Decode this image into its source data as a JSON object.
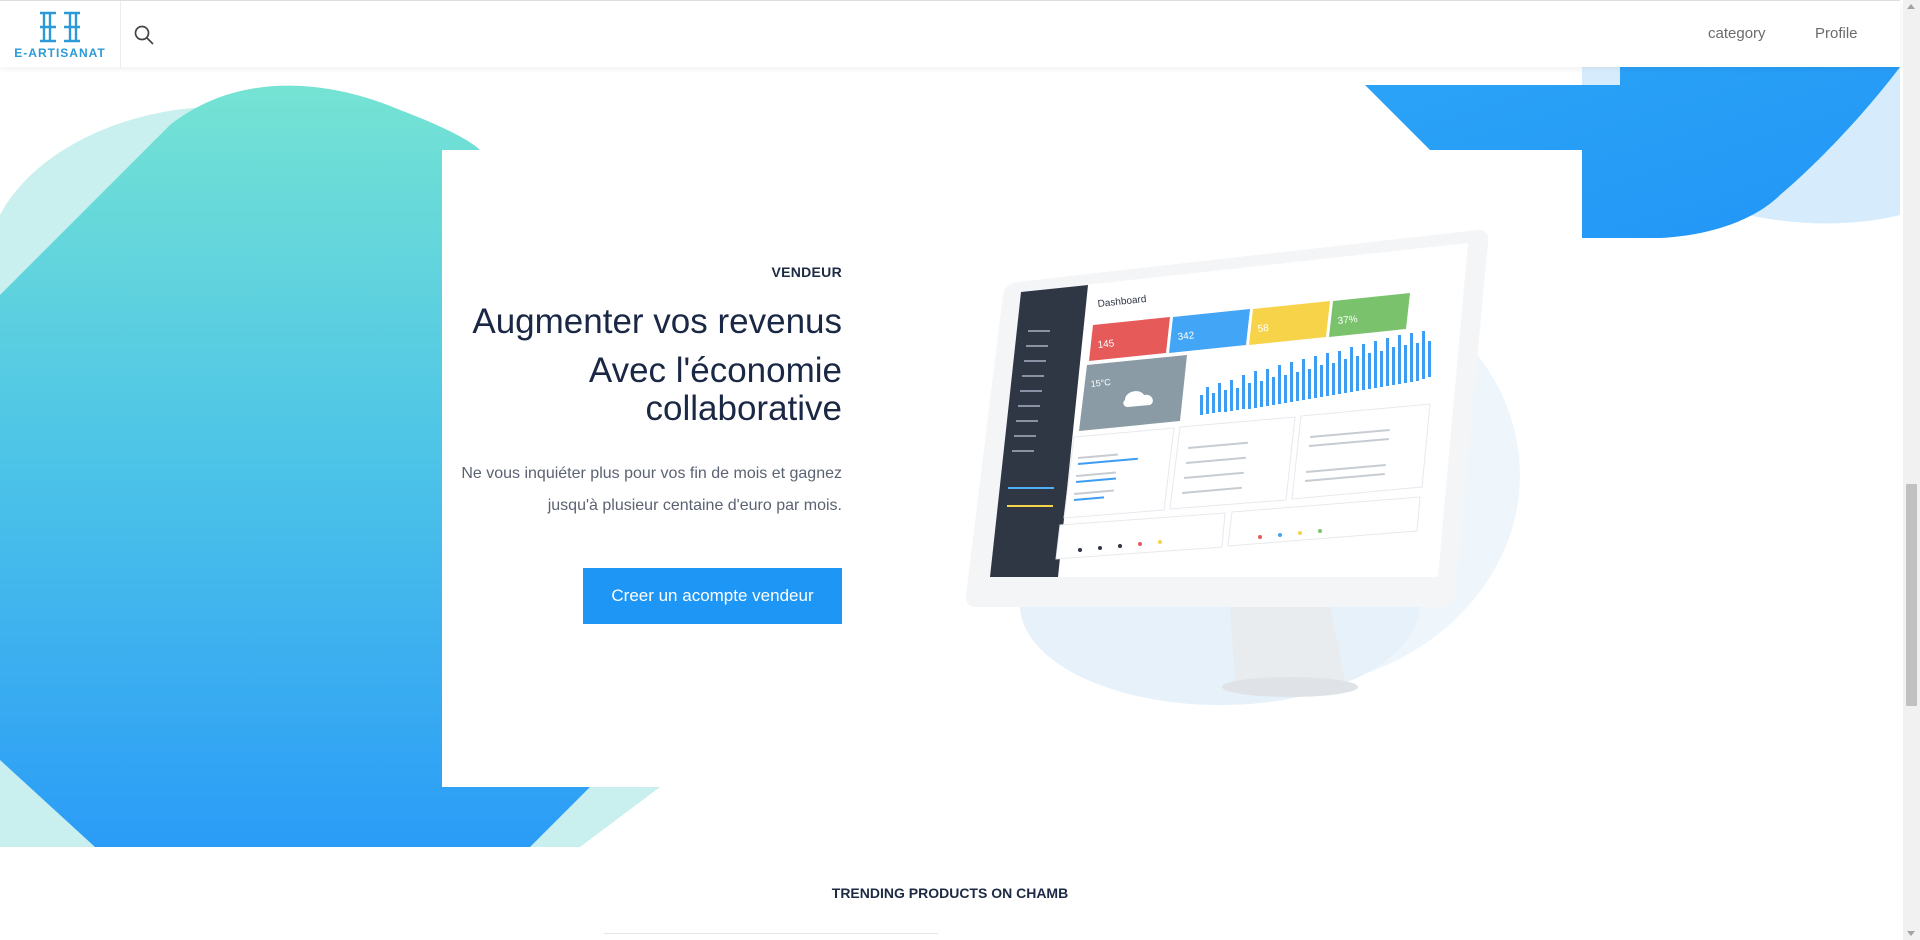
{
  "header": {
    "logo_text": "E-ARTISANAT",
    "search_icon": "search-icon",
    "nav": {
      "category_label": "category",
      "profile_label": "Profile"
    }
  },
  "hero": {
    "eyebrow": "VENDEUR",
    "title_line1": "Augmenter vos revenus",
    "title_line2": "Avec l'économie collaborative",
    "lead": "Ne vous inquiéter plus pour vos fin de mois et gagnez jusqu'à plusieur centaine d'euro par mois.",
    "cta_label": "Creer un acompte vendeur"
  },
  "illustration": {
    "dashboard_title": "Dashboard",
    "stats": [
      "145",
      "342",
      "58",
      "37%"
    ],
    "weather_temp": "15°C"
  },
  "section_heading": "TRENDING PRODUCTS ON CHAMB",
  "colors": {
    "accent": "#1e96f5",
    "teal": "#6ee0d2",
    "navy": "#1a2845"
  }
}
